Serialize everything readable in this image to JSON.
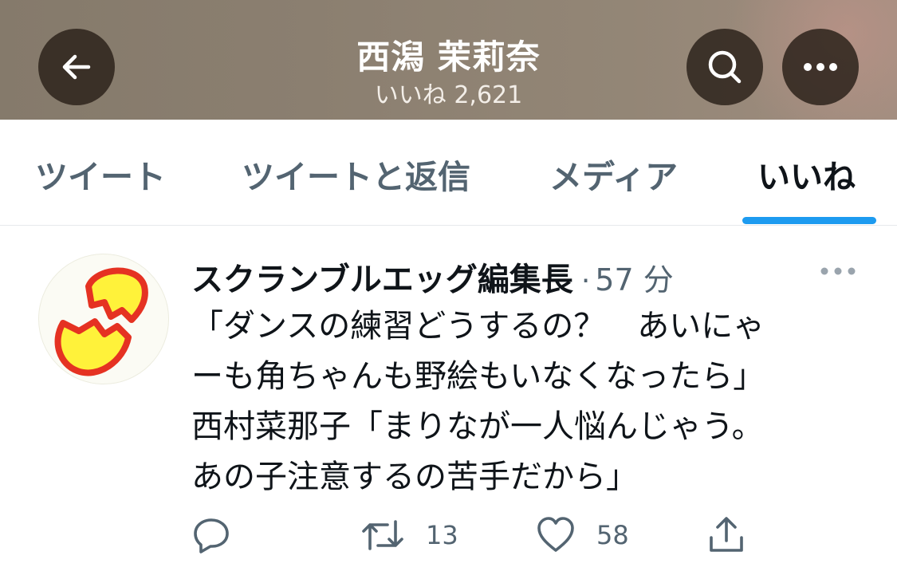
{
  "header": {
    "name": "西潟 茉莉奈",
    "likes_label": "いいね 2,621"
  },
  "icons": {
    "back": "arrow-left-icon",
    "search": "search-icon",
    "more": "more-horizontal-icon"
  },
  "tabs": [
    {
      "label": "ツイート",
      "active": false
    },
    {
      "label": "ツイートと返信",
      "active": false
    },
    {
      "label": "メディア",
      "active": false
    },
    {
      "label": "いいね",
      "active": true
    }
  ],
  "tweet": {
    "author": "スクランブルエッグ編集長",
    "separator": "·",
    "time": "57 分",
    "lines": [
      "「ダンスの練習どうするの？　あいにゃ",
      "ーも角ちゃんも野絵もいなくなったら」",
      "西村菜那子「まりなが一人悩んじゃう。",
      "あの子注意するの苦手だから」"
    ],
    "retweets": "13",
    "likes": "58"
  },
  "colors": {
    "accent": "#1d9bf0",
    "muted": "#536471",
    "text": "#0f1419"
  }
}
